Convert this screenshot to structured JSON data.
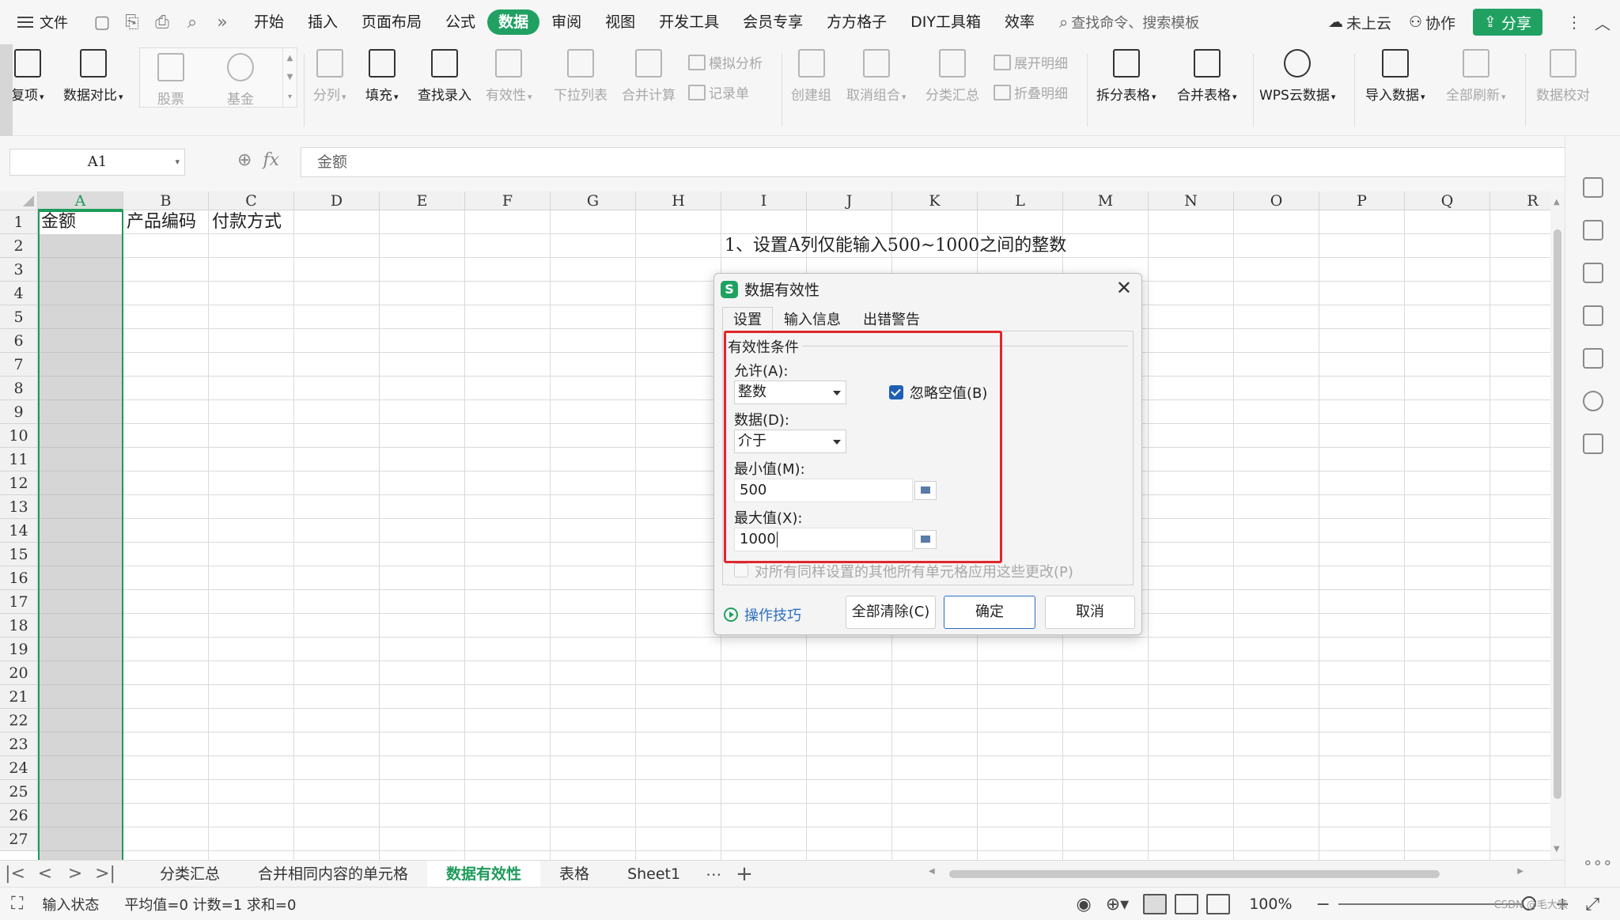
{
  "menu": {
    "file": "文件",
    "tabs": [
      "开始",
      "插入",
      "页面布局",
      "公式",
      "数据",
      "审阅",
      "视图",
      "开发工具",
      "会员专享",
      "方方格子",
      "DIY工具箱",
      "效率"
    ],
    "active_tab": "数据",
    "search": "查找命令、搜索模板",
    "cloud": "未上云",
    "collab": "协作",
    "share": "分享"
  },
  "ribbon": {
    "items": [
      "复项",
      "数据对比",
      "股票",
      "基金",
      "分列",
      "填充",
      "查找录入",
      "有效性",
      "下拉列表",
      "合并计算",
      "创建组",
      "取消组合",
      "分类汇总",
      "拆分表格",
      "合并表格",
      "WPS云数据",
      "导入数据",
      "全部刷新",
      "数据校对"
    ],
    "small_items": [
      "模拟分析",
      "记录单",
      "展开明细",
      "折叠明细"
    ]
  },
  "formula_bar": {
    "name_box": "A1",
    "fx": "fx",
    "content": "金额"
  },
  "grid": {
    "columns": [
      "A",
      "B",
      "C",
      "D",
      "E",
      "F",
      "G",
      "H",
      "I",
      "J",
      "K",
      "L",
      "M",
      "N",
      "O",
      "P",
      "Q",
      "R"
    ],
    "rows": [
      "1",
      "2",
      "3",
      "4",
      "5",
      "6",
      "7",
      "8",
      "9",
      "10",
      "11",
      "12",
      "13",
      "14",
      "15",
      "16",
      "17",
      "18",
      "19",
      "20",
      "21",
      "22",
      "23",
      "24",
      "25",
      "26",
      "27"
    ],
    "cells": {
      "A1": "金额",
      "B1": "产品编码",
      "C1": "付款方式",
      "I2": "1、设置A列仅能输入500~1000之间的整数"
    }
  },
  "dialog": {
    "title": "数据有效性",
    "tabs": [
      "设置",
      "输入信息",
      "出错警告"
    ],
    "active_tab": "设置",
    "group": "有效性条件",
    "allow_label": "允许(A):",
    "allow_value": "整数",
    "ignore_blank": "忽略空值(B)",
    "ignore_blank_checked": true,
    "data_label": "数据(D):",
    "data_value": "介于",
    "min_label": "最小值(M):",
    "min_value": "500",
    "max_label": "最大值(X):",
    "max_value": "1000",
    "apply_all": "对所有同样设置的其他所有单元格应用这些更改(P)",
    "apply_all_checked": false,
    "tips": "操作技巧",
    "clear_all": "全部清除(C)",
    "ok": "确定",
    "cancel": "取消"
  },
  "sheets": {
    "tabs": [
      "分类汇总",
      "合并相同内容的单元格",
      "数据有效性",
      "表格",
      "Sheet1"
    ],
    "active": "数据有效性"
  },
  "status": {
    "mode": "输入状态",
    "stats": "平均值=0  计数=1  求和=0",
    "zoom": "100%",
    "watermark": "CSDN @毛大猿"
  },
  "colors": {
    "accent": "#20a162",
    "highlight_box": "#e0262a",
    "link": "#2b6fc0"
  }
}
